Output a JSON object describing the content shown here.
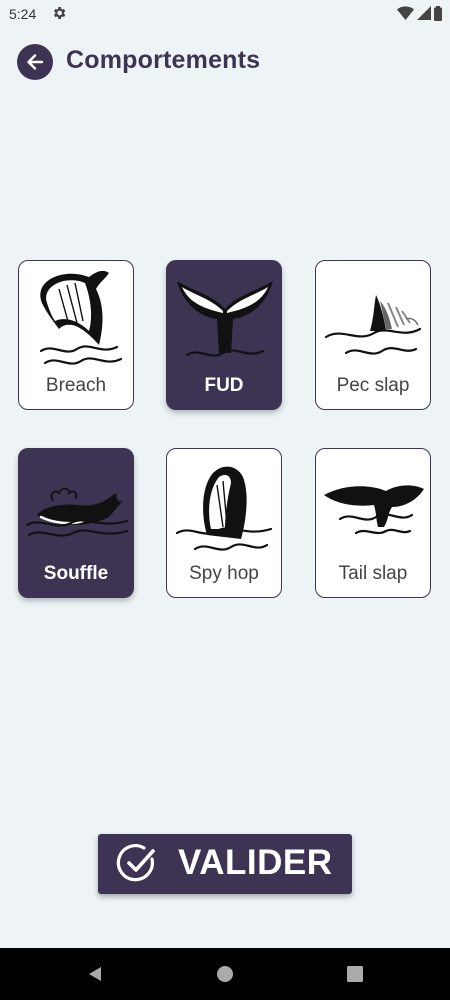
{
  "status": {
    "time": "5:24"
  },
  "header": {
    "title": "Comportements"
  },
  "behaviors": [
    {
      "label": "Breach",
      "selected": false,
      "icon": "breach-whale-icon"
    },
    {
      "label": "FUD",
      "selected": true,
      "icon": "fluke-up-dive-icon"
    },
    {
      "label": "Pec slap",
      "selected": false,
      "icon": "pec-slap-icon"
    },
    {
      "label": "Souffle",
      "selected": true,
      "icon": "blowing-whale-icon"
    },
    {
      "label": "Spy hop",
      "selected": false,
      "icon": "spy-hop-icon"
    },
    {
      "label": "Tail slap",
      "selected": false,
      "icon": "tail-slap-icon"
    }
  ],
  "actions": {
    "validate_label": "VALIDER"
  },
  "colors": {
    "primary": "#3d3454",
    "background": "#eef4f6",
    "card": "#ffffff"
  }
}
